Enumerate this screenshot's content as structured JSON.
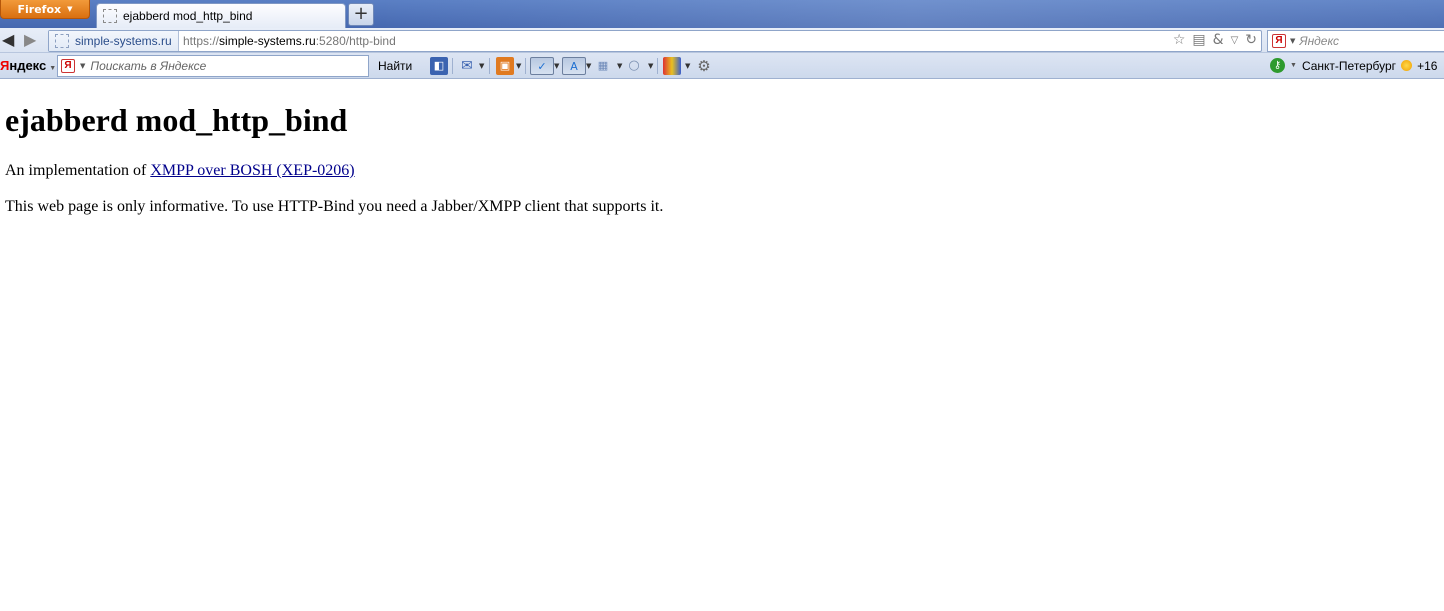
{
  "browser": {
    "app_button": "Firefox",
    "tab_title": "ejabberd mod_http_bind",
    "new_tab": "+",
    "identity_domain": "simple-systems.ru",
    "url_scheme": "https://",
    "url_host": "simple-systems.ru",
    "url_rest": ":5280/http-bind",
    "search_placeholder": "Яндекс"
  },
  "yandex_bar": {
    "brand_first": "Я",
    "brand_rest": "ндекс",
    "search_placeholder": "Поискать в Яндексе",
    "find_label": "Найти",
    "city": "Санкт-Петербург",
    "temperature": "+16"
  },
  "page": {
    "heading": "ejabberd mod_http_bind",
    "intro_prefix": "An implementation of ",
    "intro_link": "XMPP over BOSH (XEP-0206)",
    "note": "This web page is only informative. To use HTTP-Bind you need a Jabber/XMPP client that supports it."
  }
}
